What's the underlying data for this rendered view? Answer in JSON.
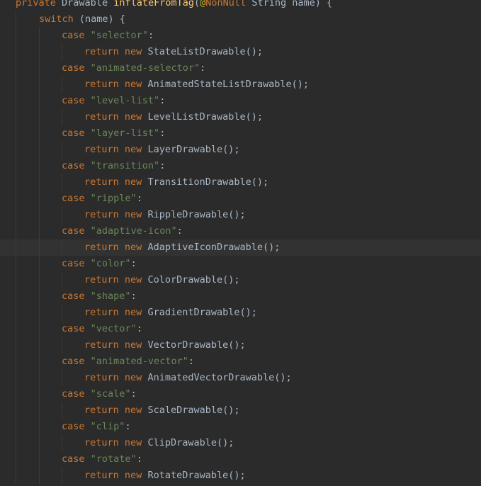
{
  "editor": {
    "signature": {
      "modifier": "private",
      "return_type": "Drawable",
      "method_name": "inflateFromTag",
      "open_paren": "(",
      "at_sign": "@",
      "annotation": "NonNull",
      "param_type": "String",
      "param_name": "name",
      "close": ") {"
    },
    "switch_line": {
      "keyword": "switch",
      "rest": " (name) {"
    },
    "keywords": {
      "case": "case",
      "return": "return",
      "new": "new"
    },
    "cases": [
      {
        "label": "\"selector\"",
        "class_name": "StateListDrawable"
      },
      {
        "label": "\"animated-selector\"",
        "class_name": "AnimatedStateListDrawable"
      },
      {
        "label": "\"level-list\"",
        "class_name": "LevelListDrawable"
      },
      {
        "label": "\"layer-list\"",
        "class_name": "LayerDrawable"
      },
      {
        "label": "\"transition\"",
        "class_name": "TransitionDrawable"
      },
      {
        "label": "\"ripple\"",
        "class_name": "RippleDrawable"
      },
      {
        "label": "\"adaptive-icon\"",
        "class_name": "AdaptiveIconDrawable"
      },
      {
        "label": "\"color\"",
        "class_name": "ColorDrawable"
      },
      {
        "label": "\"shape\"",
        "class_name": "GradientDrawable"
      },
      {
        "label": "\"vector\"",
        "class_name": "VectorDrawable"
      },
      {
        "label": "\"animated-vector\"",
        "class_name": "AnimatedVectorDrawable"
      },
      {
        "label": "\"scale\"",
        "class_name": "ScaleDrawable"
      },
      {
        "label": "\"clip\"",
        "class_name": "ClipDrawable"
      },
      {
        "label": "\"rotate\"",
        "class_name": "RotateDrawable"
      }
    ],
    "current_line_class": "AdaptiveIconDrawable",
    "colors": {
      "background": "#2b2b2b",
      "current_line": "#323232",
      "keyword": "#cc7832",
      "identifier": "#a9b7c6",
      "method_declaration": "#ffc66d",
      "annotation": "#bbb529",
      "string": "#6a8759"
    }
  }
}
